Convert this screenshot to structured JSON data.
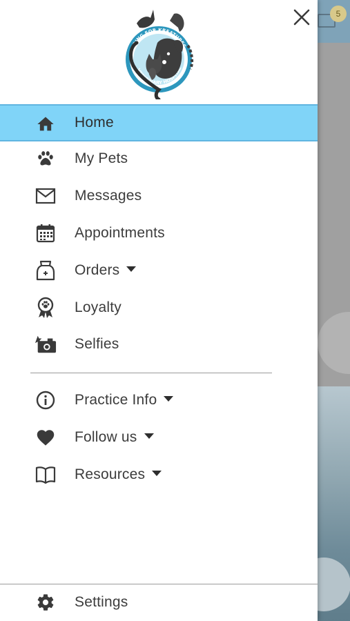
{
  "background": {
    "badge_count": "5"
  },
  "drawer": {
    "close_label": "Close",
    "logo": {
      "top_text": "KARING FOR KREATURES",
      "bottom_text": "VETERINARY HOSPITAL"
    },
    "accent_color": "#80d4f8",
    "items": [
      {
        "label": "Home",
        "icon": "home-icon"
      },
      {
        "label": "My Pets",
        "icon": "paw-icon"
      },
      {
        "label": "Messages",
        "icon": "envelope-icon"
      },
      {
        "label": "Appointments",
        "icon": "calendar-icon"
      },
      {
        "label": "Orders",
        "icon": "pet-food-bag-icon"
      },
      {
        "label": "Loyalty",
        "icon": "award-ribbon-icon"
      },
      {
        "label": "Selfies",
        "icon": "camera-icon"
      }
    ],
    "secondary_items": [
      {
        "label": "Practice Info",
        "icon": "info-icon"
      },
      {
        "label": "Follow us",
        "icon": "heart-icon"
      },
      {
        "label": "Resources",
        "icon": "book-icon"
      }
    ],
    "footer": {
      "label": "Settings",
      "icon": "gear-icon"
    }
  }
}
